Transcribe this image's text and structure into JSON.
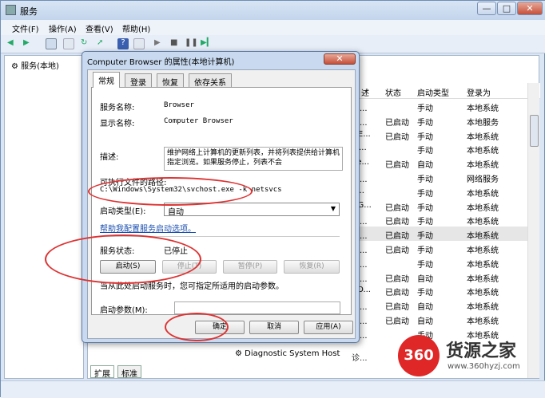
{
  "window": {
    "title": "服务",
    "minimize": "—",
    "maximize": "□",
    "close": "✕"
  },
  "menu": [
    "文件(F)",
    "操作(A)",
    "查看(V)",
    "帮助(H)"
  ],
  "left_pane": {
    "item": "服务(本地)"
  },
  "columns": {
    "desc": "述",
    "status": "状态",
    "startup": "启动类型",
    "logon": "登录为"
  },
  "rows": [
    {
      "desc": "用...",
      "status": "",
      "startup": "手动",
      "logon": "本地系统"
    },
    {
      "desc": "为...",
      "status": "已启动",
      "startup": "手动",
      "logon": "本地服务"
    },
    {
      "desc": "OE...",
      "status": "已启动",
      "startup": "手动",
      "logon": "本地系统"
    },
    {
      "desc": "in...",
      "status": "",
      "startup": "手动",
      "logon": "本地系统"
    },
    {
      "desc": "ue...",
      "status": "已启动",
      "startup": "自动",
      "logon": "本地系统"
    },
    {
      "desc": "提...",
      "status": "",
      "startup": "手动",
      "logon": "网络服务"
    },
    {
      "desc": "S...",
      "status": "",
      "startup": "手动",
      "logon": "本地系统"
    },
    {
      "desc": "NG...",
      "status": "已启动",
      "startup": "手动",
      "logon": "本地系统"
    },
    {
      "desc": "理...",
      "status": "已启动",
      "startup": "手动",
      "logon": "本地系统"
    },
    {
      "desc": "护...",
      "status": "已启动",
      "startup": "手动",
      "logon": "本地系统"
    },
    {
      "desc": "护...",
      "status": "已启动",
      "startup": "手动",
      "logon": "本地系统"
    },
    {
      "desc": "用...",
      "status": "",
      "startup": "手动",
      "logon": "本地系统"
    },
    {
      "desc": "供...",
      "status": "已启动",
      "startup": "自动",
      "logon": "本地系统"
    },
    {
      "desc": "CO...",
      "status": "已启动",
      "startup": "手动",
      "logon": "本地系统"
    },
    {
      "desc": "理...",
      "status": "已启动",
      "startup": "自动",
      "logon": "本地系统"
    },
    {
      "desc": "维...",
      "status": "已启动",
      "startup": "自动",
      "logon": "本地系统"
    },
    {
      "desc": "诊...",
      "status": "",
      "startup": "手动",
      "logon": "本地系统"
    },
    {
      "desc": "诊...",
      "status": "",
      "startup": "手动",
      "logon": "本地系统"
    }
  ],
  "visible_service": "Diagnostic System Host",
  "bottom_tabs": [
    "扩展",
    "标准"
  ],
  "dialog": {
    "title": "Computer Browser 的属性(本地计算机)",
    "close": "✕",
    "tabs": [
      "常规",
      "登录",
      "恢复",
      "依存关系"
    ],
    "service_name_label": "服务名称:",
    "service_name": "Browser",
    "display_name_label": "显示名称:",
    "display_name": "Computer Browser",
    "desc_label": "描述:",
    "description": "维护网络上计算机的更新列表，并将列表提供给计算机指定浏览。如果服务停止，列表不会",
    "path_label": "可执行文件的路径:",
    "path": "C:\\Windows\\System32\\svchost.exe -k netsvcs",
    "startup_label": "启动类型(E):",
    "startup_value": "自动",
    "help_link": "帮助我配置服务启动选项。",
    "status_label": "服务状态:",
    "status_value": "已停止",
    "btn_start": "启动(S)",
    "btn_stop": "停止(T)",
    "btn_pause": "暂停(P)",
    "btn_resume": "恢复(R)",
    "hint": "当从此处启动服务时，您可指定所适用的启动参数。",
    "param_label": "启动参数(M):",
    "ok": "确定",
    "cancel": "取消",
    "apply": "应用(A)"
  },
  "watermark": {
    "logo": "360",
    "text": "货源之家",
    "url": "www.360hyzj.com"
  }
}
